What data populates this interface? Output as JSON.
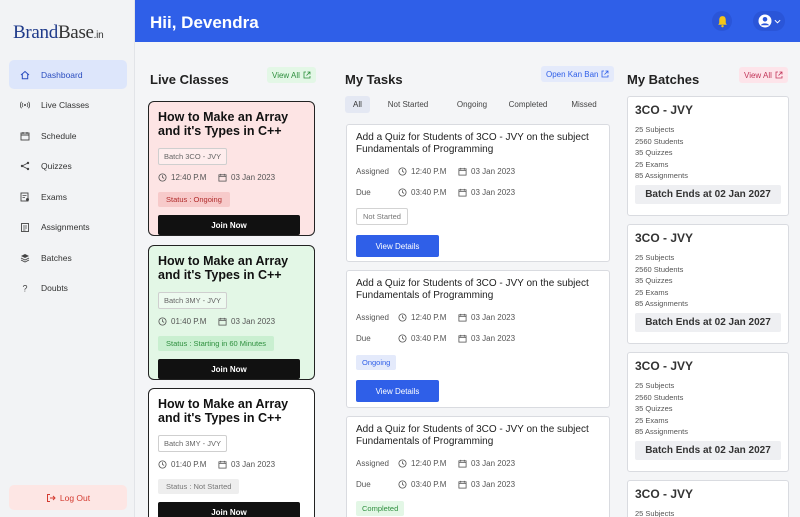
{
  "brand": {
    "part1": "Brand",
    "part2": "Base",
    "suffix": ".in"
  },
  "header": {
    "greeting": "Hii, Devendra"
  },
  "sidebar": {
    "items": [
      {
        "label": "Dashboard",
        "icon": "home-icon",
        "active": true
      },
      {
        "label": "Live Classes",
        "icon": "broadcast-icon"
      },
      {
        "label": "Schedule",
        "icon": "calendar-icon"
      },
      {
        "label": "Quizzes",
        "icon": "share-icon"
      },
      {
        "label": "Exams",
        "icon": "exam-icon"
      },
      {
        "label": "Assignments",
        "icon": "assignment-icon"
      },
      {
        "label": "Batches",
        "icon": "layers-icon"
      },
      {
        "label": "Doubts",
        "icon": "question-icon"
      }
    ],
    "logout": "Log Out"
  },
  "live": {
    "title": "Live Classes",
    "view_all": "View All",
    "cards": [
      {
        "title": "How to Make an Array and it's Types in C++",
        "batch": "Batch 3CO - JVY",
        "time": "12:40 P.M",
        "date": "03 Jan 2023",
        "status": "Status : Ongoing",
        "join": "Join Now"
      },
      {
        "title": "How to Make an Array and it's Types in C++",
        "batch": "Batch 3MY - JVY",
        "time": "01:40 P.M",
        "date": "03 Jan 2023",
        "status": "Status : Starting in 60 Minutes",
        "join": "Join Now"
      },
      {
        "title": "How to Make an Array and it's Types in C++",
        "batch": "Batch 3MY - JVY",
        "time": "01:40 P.M",
        "date": "03 Jan 2023",
        "status": "Status : Not Started",
        "join": "Join Now"
      }
    ]
  },
  "tasks": {
    "title": "My Tasks",
    "open_kanban": "Open Kan Ban",
    "tabs": [
      "All",
      "Not Started",
      "Ongoing",
      "Completed",
      "Missed"
    ],
    "cards": [
      {
        "title": "Add a Quiz for Students of 3CO - JVY on the subject Fundamentals of Programming",
        "assigned_label": "Assigned",
        "assigned_time": "12:40 P.M",
        "assigned_date": "03 Jan 2023",
        "due_label": "Due",
        "due_time": "03:40 P.M",
        "due_date": "03 Jan 2023",
        "status": "Not Started",
        "action": "View Details"
      },
      {
        "title": "Add a Quiz for Students of 3CO - JVY on the subject Fundamentals of Programming",
        "assigned_label": "Assigned",
        "assigned_time": "12:40 P.M",
        "assigned_date": "03 Jan 2023",
        "due_label": "Due",
        "due_time": "03:40 P.M",
        "due_date": "03 Jan 2023",
        "status": "Ongoing",
        "action": "View Details"
      },
      {
        "title": "Add a Quiz for Students of 3CO - JVY on the subject Fundamentals of Programming",
        "assigned_label": "Assigned",
        "assigned_time": "12:40 P.M",
        "assigned_date": "03 Jan 2023",
        "due_label": "Due",
        "due_time": "03:40 P.M",
        "due_date": "03 Jan 2023",
        "status": "Completed"
      }
    ]
  },
  "batches": {
    "title": "My Batches",
    "view_all": "View All",
    "cards": [
      {
        "name": "3CO - JVY",
        "subjects": "25 Subjects",
        "students": "2560 Students",
        "quizzes": "35 Quizzes",
        "exams": "25 Exams",
        "assignments": "85 Assignments",
        "ends": "Batch Ends at 02 Jan 2027"
      },
      {
        "name": "3CO - JVY",
        "subjects": "25 Subjects",
        "students": "2560 Students",
        "quizzes": "35 Quizzes",
        "exams": "25 Exams",
        "assignments": "85 Assignments",
        "ends": "Batch Ends at 02 Jan 2027"
      },
      {
        "name": "3CO - JVY",
        "subjects": "25 Subjects",
        "students": "2560 Students",
        "quizzes": "35 Quizzes",
        "exams": "25 Exams",
        "assignments": "85 Assignments",
        "ends": "Batch Ends at 02 Jan 2027"
      },
      {
        "name": "3CO - JVY",
        "subjects": "25 Subjects"
      }
    ]
  },
  "colors": {
    "primary": "#2f5fe8",
    "ongoing_bg": "#fde4e4",
    "upcoming_bg": "#e3f7e6",
    "logout": "#d43b30",
    "bell": "#f5c518"
  }
}
